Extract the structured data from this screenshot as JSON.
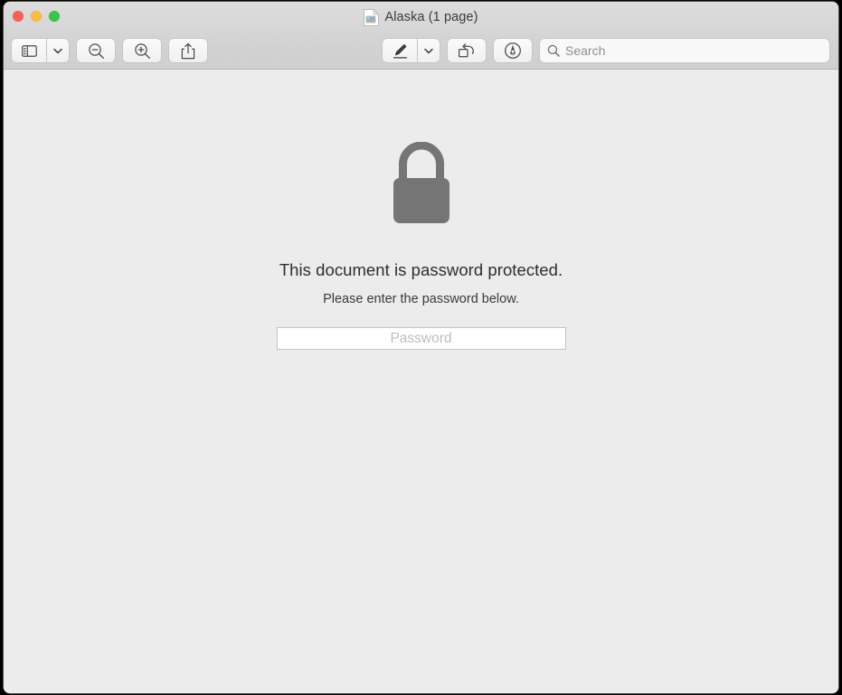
{
  "window": {
    "title": "Alaska (1 page)",
    "doc_icon": "image-document-icon",
    "traffic_lights": [
      {
        "name": "close-button",
        "color": "#fc6058"
      },
      {
        "name": "minimize-button",
        "color": "#fdbc40"
      },
      {
        "name": "maximize-button",
        "color": "#34c749"
      }
    ]
  },
  "toolbar": {
    "left_items": [
      {
        "name": "sidebar-toggle-button",
        "icon": "sidebar-icon",
        "has_menu": true
      },
      {
        "name": "zoom-out-button",
        "icon": "zoom-out-icon",
        "has_menu": false
      },
      {
        "name": "zoom-in-button",
        "icon": "zoom-in-icon",
        "has_menu": false
      },
      {
        "name": "share-button",
        "icon": "share-icon",
        "has_menu": false
      }
    ],
    "right_items": [
      {
        "name": "markup-button",
        "icon": "marker-pen-icon",
        "has_menu": true
      },
      {
        "name": "rotate-button",
        "icon": "rotate-left-icon",
        "has_menu": false
      },
      {
        "name": "annotate-button",
        "icon": "pen-nib-circle-icon",
        "has_menu": false
      }
    ]
  },
  "search": {
    "icon": "search-icon",
    "placeholder": "Search",
    "value": ""
  },
  "main": {
    "lock_icon": "lock-closed-icon",
    "lock_color": "#757575",
    "primary_message": "This document is password protected.",
    "secondary_message": "Please enter the password below.",
    "password_field": {
      "placeholder": "Password",
      "value": ""
    }
  },
  "colors": {
    "titlebar": "#d8d8d8",
    "toolbar": "#d2d2d2",
    "content_background": "#ececec",
    "lock_gray": "#757575",
    "text_primary": "#2e2e2e"
  }
}
